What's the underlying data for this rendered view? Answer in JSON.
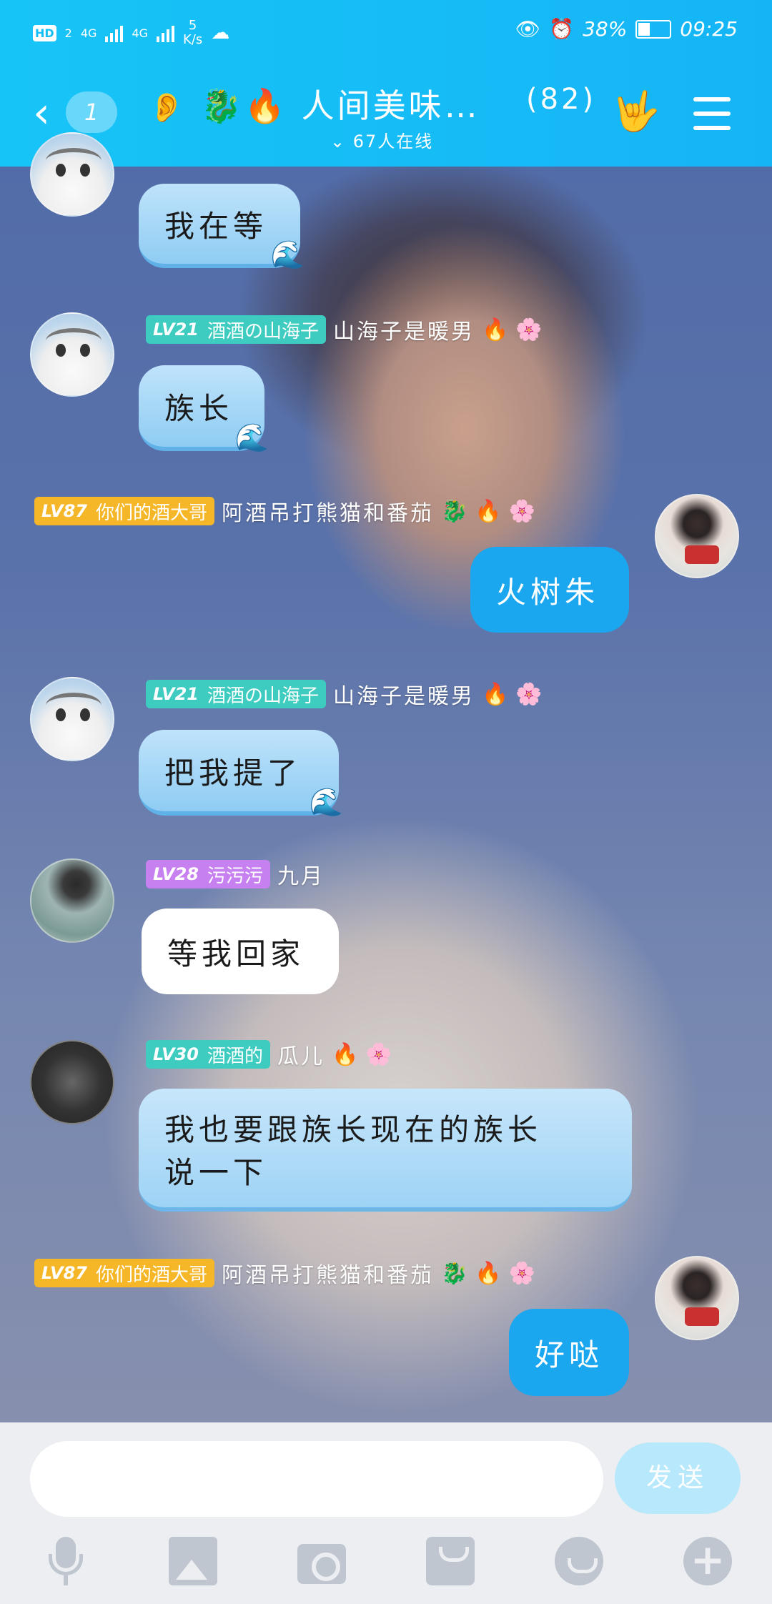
{
  "status_bar": {
    "network_hd": "HD",
    "sim_slot": "2",
    "net1": "4G",
    "net2": "4G",
    "speed_value": "5",
    "speed_unit": "K/s",
    "battery": "38%",
    "battery_level": 0.38,
    "time": "09:25"
  },
  "header": {
    "back_badge": "1",
    "group_name": "人间美味…",
    "member_count": "(82)",
    "online": "67人在线"
  },
  "messages": [
    {
      "text": "我在等"
    },
    {
      "level": "LV21",
      "title": "酒酒の山海子",
      "nick": "山海子是暖男",
      "text": "族长"
    },
    {
      "level": "LV87",
      "title": "你们的酒大哥",
      "nick": "阿酒吊打熊猫和番茄",
      "text": "火树朱"
    },
    {
      "level": "LV21",
      "title": "酒酒の山海子",
      "nick": "山海子是暖男",
      "text": "把我提了"
    },
    {
      "level": "LV28",
      "title": "污污污",
      "nick": "九月",
      "text": "等我回家"
    },
    {
      "level": "LV30",
      "title": "酒酒的",
      "nick": "瓜儿",
      "text_line1": "我也要跟族长现在的族长",
      "text_line2": "说一下"
    },
    {
      "level": "LV87",
      "title": "你们的酒大哥",
      "nick": "阿酒吊打熊猫和番茄",
      "text": "好哒"
    }
  ],
  "input_bar": {
    "send_label": "发送"
  },
  "icons": [
    "microphone-icon",
    "image-icon",
    "camera-icon",
    "red-packet-icon",
    "emoji-icon",
    "plus-icon"
  ],
  "colors": {
    "header_blue": "#17c4f7",
    "my_bubble": "#1aa7f0",
    "lv_teal": "#3ecbc0",
    "lv_gold": "#f5b728",
    "lv_purple": "#c780f0"
  }
}
